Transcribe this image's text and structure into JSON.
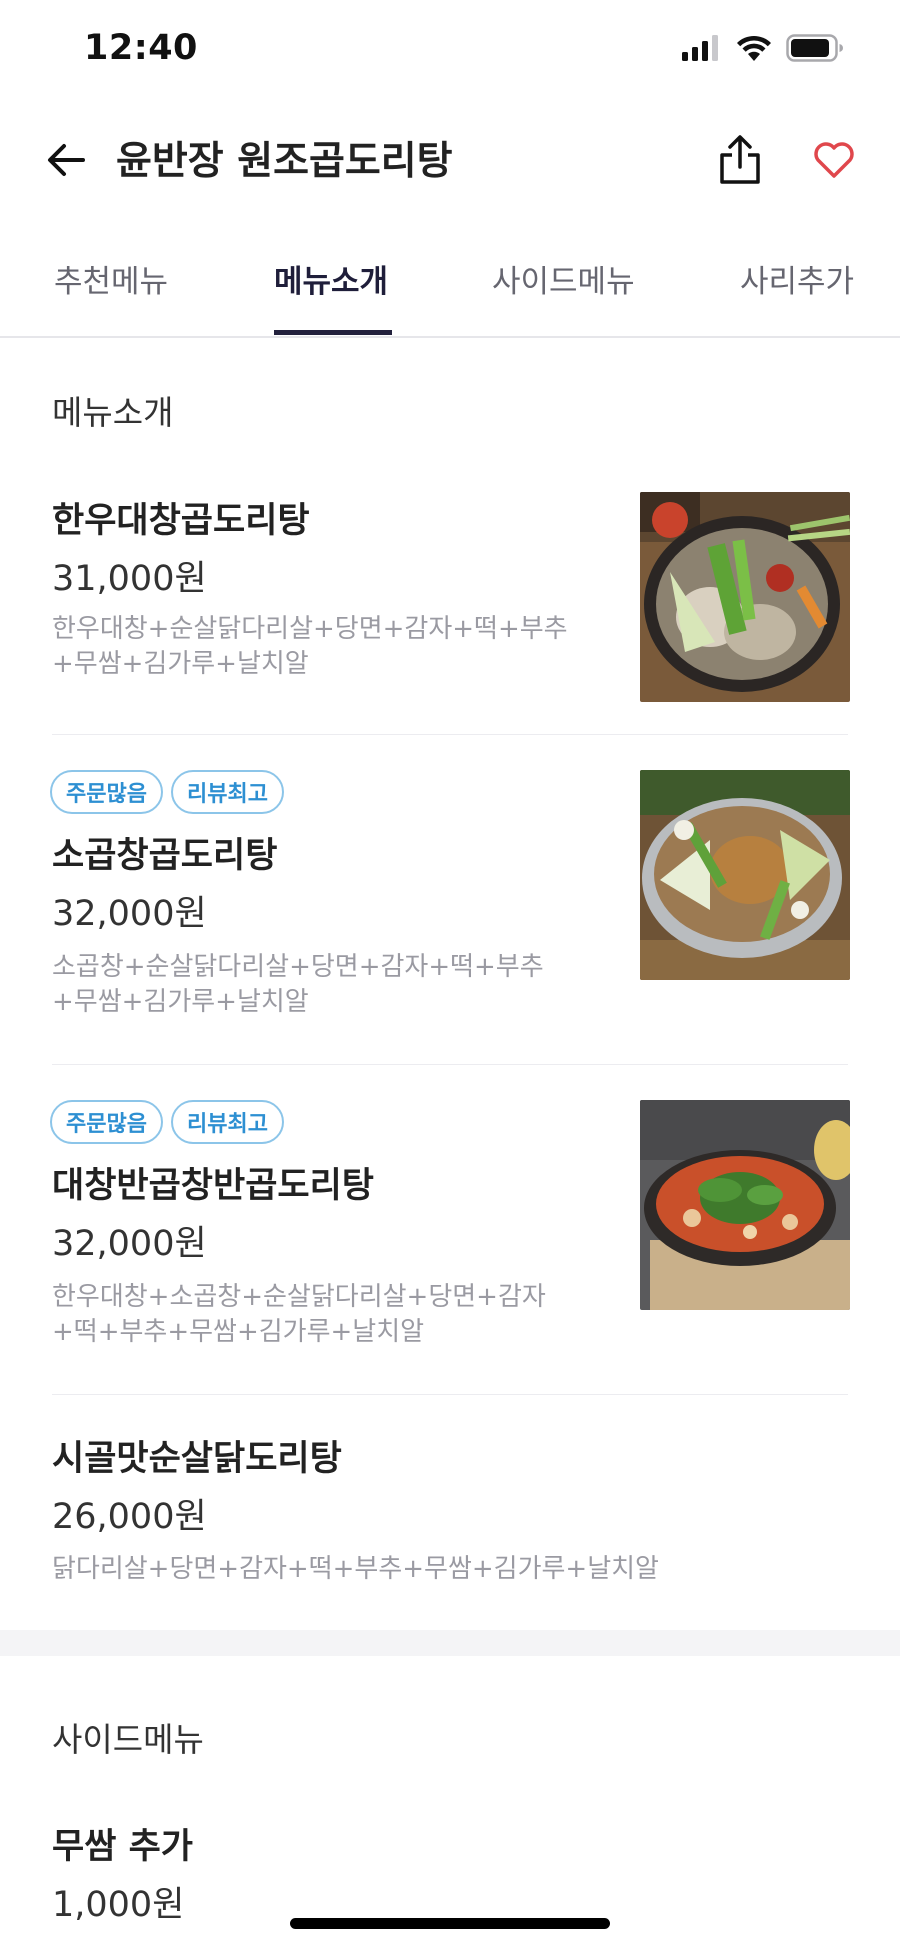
{
  "status_bar": {
    "time": "12:40",
    "icons": [
      "signal-icon",
      "wifi-icon",
      "battery-icon"
    ]
  },
  "header": {
    "title": "윤반장 원조곱도리탕",
    "icons": [
      "back-arrow-icon",
      "share-icon",
      "heart-icon"
    ],
    "heart_color": "#e0474c"
  },
  "tabs": [
    {
      "label": "추천메뉴",
      "active": false
    },
    {
      "label": "메뉴소개",
      "active": true
    },
    {
      "label": "사이드메뉴",
      "active": false
    },
    {
      "label": "사리추가",
      "active": false
    }
  ],
  "menu_intro": {
    "heading": "메뉴소개",
    "items": [
      {
        "badges": [],
        "name": "한우대창곱도리탕",
        "price": "31,000원",
        "description": [
          "한우대창+순살닭다리살+당면+감자+떡+부추",
          "+무쌈+김가루+날치알"
        ],
        "photo": "food-photo-hotpot-1"
      },
      {
        "badges": [
          "주문많음",
          "리뷰최고"
        ],
        "name": "소곱창곱도리탕",
        "price": "32,000원",
        "description": [
          "소곱창+순살닭다리살+당면+감자+떡+부추",
          "+무쌈+김가루+날치알"
        ],
        "photo": "food-photo-hotpot-2"
      },
      {
        "badges": [
          "주문많음",
          "리뷰최고"
        ],
        "name": "대창반곱창반곱도리탕",
        "price": "32,000원",
        "description": [
          "한우대창+소곱창+순살닭다리살+당면+감자",
          "+떡+부추+무쌈+김가루+날치알"
        ],
        "photo": "food-photo-hotpot-3"
      },
      {
        "badges": [],
        "name": "시골맛순살닭도리탕",
        "price": "26,000원",
        "description": [
          "닭다리살+당면+감자+떡+부추+무쌈+김가루+날치알"
        ],
        "photo": null
      }
    ]
  },
  "side_menu": {
    "heading": "사이드메뉴",
    "items": [
      {
        "name": "무쌈 추가",
        "price": "1,000원"
      }
    ]
  },
  "colors": {
    "badge_text": "#2d8fd2",
    "badge_border": "#8cc5e9",
    "active_tab": "#23213d",
    "description_text": "#9a9aa2"
  }
}
